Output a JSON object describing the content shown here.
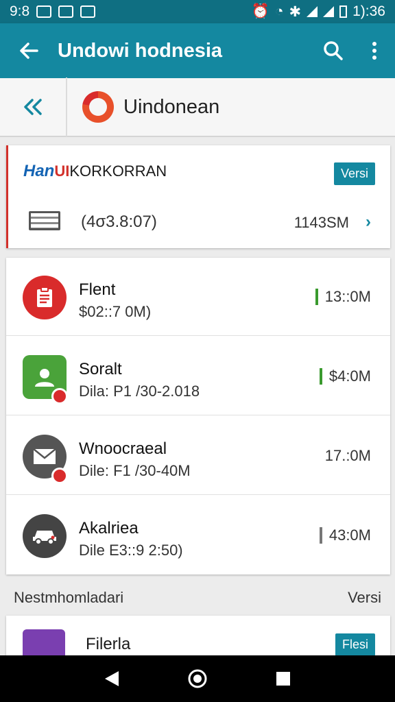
{
  "status_bar": {
    "time_left": "9:8",
    "time_right": "1):36"
  },
  "app_bar": {
    "title": "Undowi hodnesia"
  },
  "sub_header": {
    "app_name": "Uindonean"
  },
  "top_card": {
    "brand_part1": "Han",
    "brand_part2": "UI",
    "brand_part3": "KORKORRAN",
    "badge": "Versi",
    "meta": "(4σ3.8:07)",
    "size": "1143SM"
  },
  "list": [
    {
      "name": "Flent",
      "sub": "$02::7 0M)",
      "value": "13::0M",
      "mark": "green",
      "icon": "clipboard-icon"
    },
    {
      "name": "Soralt",
      "sub": "Dila: P1 /30-2.018",
      "value": "$4:0M",
      "mark": "green",
      "icon": "user-icon"
    },
    {
      "name": "Wnoocraeal",
      "sub": "Dile: F1 /30-40M",
      "value": "17.:0M",
      "mark": "none",
      "icon": "mail-icon"
    },
    {
      "name": "Akalriea",
      "sub": "Dile E3::9 2:50)",
      "value": "43:0M",
      "mark": "grey",
      "icon": "car-icon"
    }
  ],
  "section": {
    "left": "Nestmhomladari",
    "right": "Versi"
  },
  "bottom_card": {
    "name": "Filerla",
    "badge": "Flesi"
  }
}
